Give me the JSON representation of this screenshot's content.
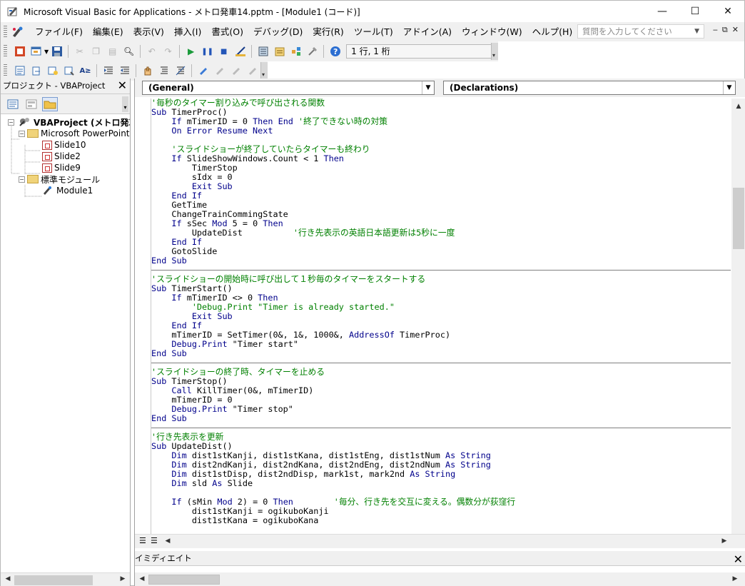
{
  "window": {
    "title": "Microsoft Visual Basic for Applications - メトロ発車14.pptm - [Module1 (コード)]",
    "minimize": "—",
    "maximize": "☐",
    "close": "✕"
  },
  "menubar": {
    "items": [
      "ファイル(F)",
      "編集(E)",
      "表示(V)",
      "挿入(I)",
      "書式(O)",
      "デバッグ(D)",
      "実行(R)",
      "ツール(T)",
      "アドイン(A)",
      "ウィンドウ(W)",
      "ヘルプ(H)"
    ],
    "help_placeholder": "質問を入力してください",
    "mdi_min": "‒",
    "mdi_restore": "⧉",
    "mdi_close": "✕"
  },
  "toolbar": {
    "position": "1 行, 1 桁"
  },
  "project": {
    "title": "プロジェクト - VBAProject",
    "close": "✕",
    "tree": [
      {
        "label": "VBAProject (メトロ発車",
        "level": 0,
        "bold": true
      },
      {
        "label": "Microsoft PowerPoint O",
        "level": 1
      },
      {
        "label": "Slide10",
        "level": 2
      },
      {
        "label": "Slide2",
        "level": 2
      },
      {
        "label": "Slide9",
        "level": 2
      },
      {
        "label": "標準モジュール",
        "level": 1
      },
      {
        "label": "Module1",
        "level": 2
      }
    ]
  },
  "code_window": {
    "object_combo": "(General)",
    "proc_combo": "(Declarations)",
    "lines": [
      [
        [
          "cm",
          "'毎秒のタイマー割り込みで呼び出される関数"
        ]
      ],
      [
        [
          "kw",
          "Sub "
        ],
        [
          "tx",
          "TimerProc()"
        ]
      ],
      [
        [
          "tx",
          "    "
        ],
        [
          "kw",
          "If "
        ],
        [
          "tx",
          "mTimerID = 0 "
        ],
        [
          "kw",
          "Then End "
        ],
        [
          "cm",
          "'終了できない時の対策"
        ]
      ],
      [
        [
          "tx",
          "    "
        ],
        [
          "kw",
          "On Error Resume Next"
        ]
      ],
      [
        [
          "tx",
          ""
        ]
      ],
      [
        [
          "tx",
          "    "
        ],
        [
          "cm",
          "'スライドショーが終了していたらタイマーも終わり"
        ]
      ],
      [
        [
          "tx",
          "    "
        ],
        [
          "kw",
          "If "
        ],
        [
          "tx",
          "SlideShowWindows.Count < 1 "
        ],
        [
          "kw",
          "Then"
        ]
      ],
      [
        [
          "tx",
          "        TimerStop"
        ]
      ],
      [
        [
          "tx",
          "        sIdx = 0"
        ]
      ],
      [
        [
          "tx",
          "        "
        ],
        [
          "kw",
          "Exit Sub"
        ]
      ],
      [
        [
          "tx",
          "    "
        ],
        [
          "kw",
          "End If"
        ]
      ],
      [
        [
          "tx",
          "    GetTime"
        ]
      ],
      [
        [
          "tx",
          "    ChangeTrainCommingState"
        ]
      ],
      [
        [
          "tx",
          "    "
        ],
        [
          "kw",
          "If "
        ],
        [
          "tx",
          "sSec "
        ],
        [
          "kw",
          "Mod "
        ],
        [
          "tx",
          "5 = 0 "
        ],
        [
          "kw",
          "Then"
        ]
      ],
      [
        [
          "tx",
          "        UpdateDist          "
        ],
        [
          "cm",
          "'行き先表示の英語日本語更新は5秒に一度"
        ]
      ],
      [
        [
          "tx",
          "    "
        ],
        [
          "kw",
          "End If"
        ]
      ],
      [
        [
          "tx",
          "    GotoSlide"
        ]
      ],
      [
        [
          "kw",
          "End Sub"
        ]
      ],
      [
        [
          "sep",
          ""
        ]
      ],
      [
        [
          "cm",
          "'スライドショーの開始時に呼び出して１秒毎のタイマーをスタートする"
        ]
      ],
      [
        [
          "kw",
          "Sub "
        ],
        [
          "tx",
          "TimerStart()"
        ]
      ],
      [
        [
          "tx",
          "    "
        ],
        [
          "kw",
          "If "
        ],
        [
          "tx",
          "mTimerID <> 0 "
        ],
        [
          "kw",
          "Then"
        ]
      ],
      [
        [
          "tx",
          "        "
        ],
        [
          "cm",
          "'Debug.Print \"Timer is already started.\""
        ]
      ],
      [
        [
          "tx",
          "        "
        ],
        [
          "kw",
          "Exit Sub"
        ]
      ],
      [
        [
          "tx",
          "    "
        ],
        [
          "kw",
          "End If"
        ]
      ],
      [
        [
          "tx",
          "    mTimerID = SetTimer(0&, 1&, 1000&, "
        ],
        [
          "kw",
          "AddressOf "
        ],
        [
          "tx",
          "TimerProc)"
        ]
      ],
      [
        [
          "tx",
          "    "
        ],
        [
          "kw",
          "Debug.Print "
        ],
        [
          "tx",
          "\"Timer start\""
        ]
      ],
      [
        [
          "kw",
          "End Sub"
        ]
      ],
      [
        [
          "sep",
          ""
        ]
      ],
      [
        [
          "cm",
          "'スライドショーの終了時、タイマーを止める"
        ]
      ],
      [
        [
          "kw",
          "Sub "
        ],
        [
          "tx",
          "TimerStop()"
        ]
      ],
      [
        [
          "tx",
          "    "
        ],
        [
          "kw",
          "Call "
        ],
        [
          "tx",
          "KillTimer(0&, mTimerID)"
        ]
      ],
      [
        [
          "tx",
          "    mTimerID = 0"
        ]
      ],
      [
        [
          "tx",
          "    "
        ],
        [
          "kw",
          "Debug.Print "
        ],
        [
          "tx",
          "\"Timer stop\""
        ]
      ],
      [
        [
          "kw",
          "End Sub"
        ]
      ],
      [
        [
          "sep",
          ""
        ]
      ],
      [
        [
          "cm",
          "'行き先表示を更新"
        ]
      ],
      [
        [
          "kw",
          "Sub "
        ],
        [
          "tx",
          "UpdateDist()"
        ]
      ],
      [
        [
          "tx",
          "    "
        ],
        [
          "kw",
          "Dim "
        ],
        [
          "tx",
          "dist1stKanji, dist1stKana, dist1stEng, dist1stNum "
        ],
        [
          "kw",
          "As String"
        ]
      ],
      [
        [
          "tx",
          "    "
        ],
        [
          "kw",
          "Dim "
        ],
        [
          "tx",
          "dist2ndKanji, dist2ndKana, dist2ndEng, dist2ndNum "
        ],
        [
          "kw",
          "As String"
        ]
      ],
      [
        [
          "tx",
          "    "
        ],
        [
          "kw",
          "Dim "
        ],
        [
          "tx",
          "dist1stDisp, dist2ndDisp, mark1st, mark2nd "
        ],
        [
          "kw",
          "As String"
        ]
      ],
      [
        [
          "tx",
          "    "
        ],
        [
          "kw",
          "Dim "
        ],
        [
          "tx",
          "sld "
        ],
        [
          "kw",
          "As "
        ],
        [
          "tx",
          "Slide"
        ]
      ],
      [
        [
          "tx",
          ""
        ]
      ],
      [
        [
          "tx",
          "    "
        ],
        [
          "kw",
          "If "
        ],
        [
          "tx",
          "(sMin "
        ],
        [
          "kw",
          "Mod "
        ],
        [
          "tx",
          "2) = 0 "
        ],
        [
          "kw",
          "Then        "
        ],
        [
          "cm",
          "'毎分、行き先を交互に変える。偶数分が荻窪行"
        ]
      ],
      [
        [
          "tx",
          "        dist1stKanji = ogikuboKanji"
        ]
      ],
      [
        [
          "tx",
          "        dist1stKana = ogikuboKana"
        ]
      ]
    ]
  },
  "immediate": {
    "title": "イミディエイト",
    "close": "✕"
  }
}
